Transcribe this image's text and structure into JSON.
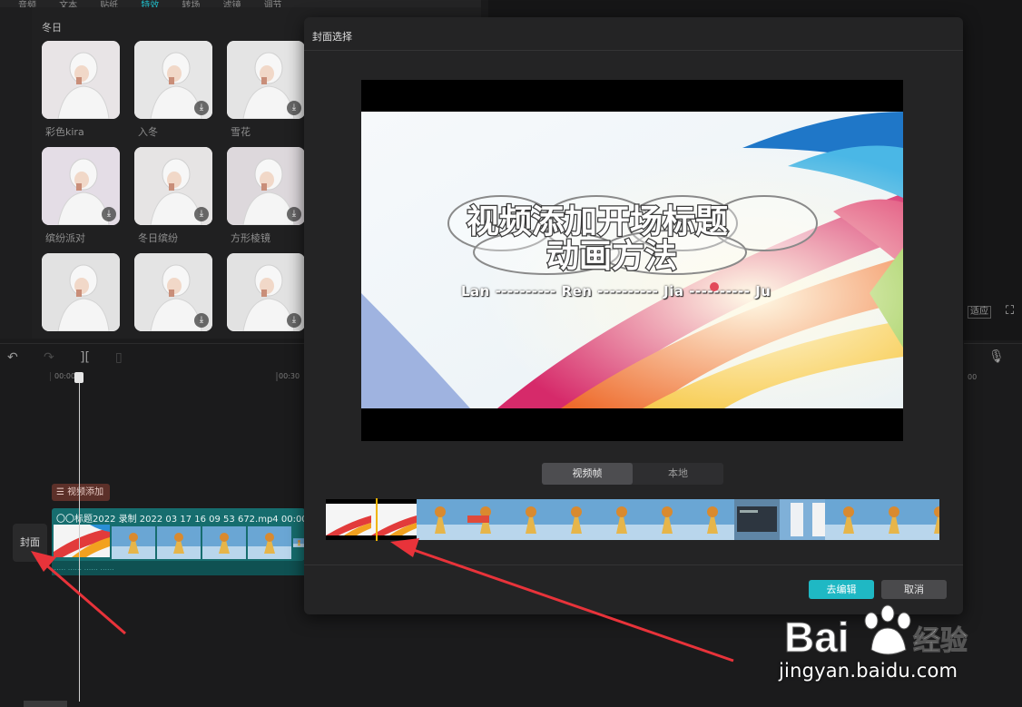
{
  "top_tabs": [
    "音频",
    "文本",
    "贴纸",
    "特效",
    "转场",
    "滤镜",
    "调节"
  ],
  "effects": {
    "section_title": "冬日",
    "items": [
      {
        "label": "彩色kira"
      },
      {
        "label": "入冬"
      },
      {
        "label": "雪花"
      },
      {
        "label": "缤纷派对"
      },
      {
        "label": "冬日缤纷"
      },
      {
        "label": "方形棱镜"
      },
      {
        "label": ""
      },
      {
        "label": ""
      },
      {
        "label": ""
      }
    ]
  },
  "timeline": {
    "ruler": [
      "00:00",
      "00:30"
    ],
    "title_clip": "视频添加",
    "video_clip": "〇〇标题2022  录制 2022 03 17 16 09 53 672.mp4   00:00",
    "audio_clip": "......  ......  ......  ......",
    "cover_button": "封面"
  },
  "right_panel": {
    "fit_label": "适应",
    "ruler_label": "00"
  },
  "dialog": {
    "title": "封面选择",
    "preview_title_line1": "视频添加开场标题",
    "preview_title_line2": "动画方法",
    "preview_subtitle": "Lan ---------- Ren ---------- Jia ---------- Ju",
    "tabs": [
      {
        "label": "视频帧",
        "active": true
      },
      {
        "label": "本地",
        "active": false
      }
    ],
    "confirm_button": "去编辑",
    "cancel_button": "取消"
  },
  "watermark": {
    "brand": "Bai",
    "brand_suffix": "经验",
    "url": "jingyan.baidu.com"
  },
  "colors": {
    "accent": "#1fb8c4",
    "marker": "#f0b400",
    "arrow": "#e8333a"
  }
}
